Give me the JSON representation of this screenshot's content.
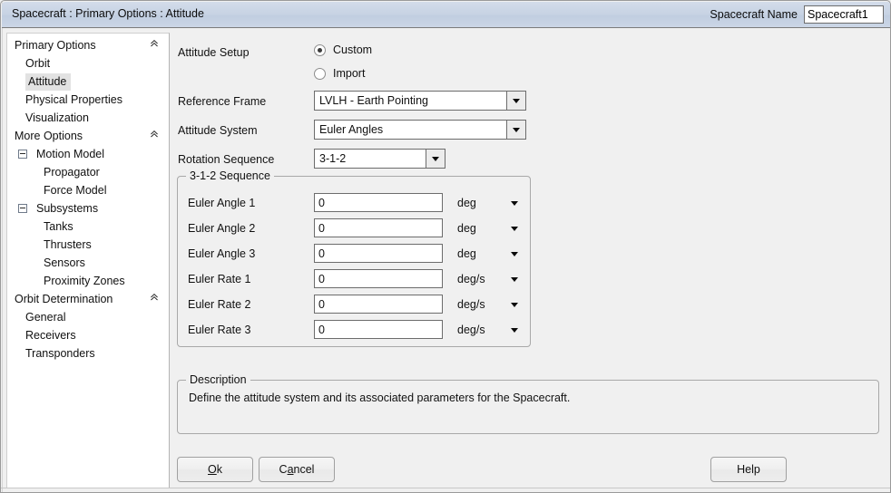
{
  "window": {
    "title": "Spacecraft : Primary Options : Attitude",
    "spacecraft_name_label": "Spacecraft Name",
    "spacecraft_name_value": "Spacecraft1"
  },
  "sidebar": {
    "items": [
      {
        "label": "Primary Options",
        "level": "group",
        "chevron": "chevron-double-up-icon",
        "selected": false
      },
      {
        "label": "Orbit",
        "level": "lvl1",
        "selected": false
      },
      {
        "label": "Attitude",
        "level": "lvl1",
        "selected": true
      },
      {
        "label": "Physical Properties",
        "level": "lvl1",
        "selected": false
      },
      {
        "label": "Visualization",
        "level": "lvl1",
        "selected": false
      },
      {
        "label": "More Options",
        "level": "group",
        "chevron": "chevron-double-up-icon",
        "selected": false
      },
      {
        "label": "Motion Model",
        "level": "lvl1b",
        "expander": "minus-box-icon",
        "selected": false
      },
      {
        "label": "Propagator",
        "level": "lvl2",
        "selected": false
      },
      {
        "label": "Force Model",
        "level": "lvl2",
        "selected": false
      },
      {
        "label": "Subsystems",
        "level": "lvl1b",
        "expander": "minus-box-icon",
        "selected": false
      },
      {
        "label": "Tanks",
        "level": "lvl2",
        "selected": false
      },
      {
        "label": "Thrusters",
        "level": "lvl2",
        "selected": false
      },
      {
        "label": "Sensors",
        "level": "lvl2",
        "selected": false
      },
      {
        "label": "Proximity Zones",
        "level": "lvl2",
        "selected": false
      },
      {
        "label": "Orbit Determination",
        "level": "group",
        "chevron": "chevron-double-up-icon",
        "selected": false
      },
      {
        "label": "General",
        "level": "lvl1",
        "selected": false
      },
      {
        "label": "Receivers",
        "level": "lvl1",
        "selected": false
      },
      {
        "label": "Transponders",
        "level": "lvl1",
        "selected": false
      }
    ]
  },
  "form": {
    "attitude_setup_label": "Attitude Setup",
    "radio_custom_label": "Custom",
    "radio_import_label": "Import",
    "radio_selected": "Custom",
    "reference_frame_label": "Reference Frame",
    "reference_frame_value": "LVLH - Earth Pointing",
    "attitude_system_label": "Attitude System",
    "attitude_system_value": "Euler Angles",
    "rotation_sequence_label": "Rotation Sequence",
    "rotation_sequence_value": "3-1-2"
  },
  "sequence_group": {
    "title": "3-1-2 Sequence",
    "rows": [
      {
        "label": "Euler Angle 1",
        "value": "0",
        "unit": "deg"
      },
      {
        "label": "Euler Angle 2",
        "value": "0",
        "unit": "deg"
      },
      {
        "label": "Euler Angle 3",
        "value": "0",
        "unit": "deg"
      },
      {
        "label": "Euler Rate 1",
        "value": "0",
        "unit": "deg/s"
      },
      {
        "label": "Euler Rate 2",
        "value": "0",
        "unit": "deg/s"
      },
      {
        "label": "Euler Rate 3",
        "value": "0",
        "unit": "deg/s"
      }
    ]
  },
  "description": {
    "title": "Description",
    "text": "Define the attitude system and its associated parameters for the Spacecraft."
  },
  "buttons": {
    "ok": "Ok",
    "ok_mnemonic": "O",
    "cancel": "Cancel",
    "cancel_mnemonic": "a",
    "help": "Help"
  },
  "colors": {
    "titlebar": "#c6d2e3",
    "panel_bg": "#f0f0f0",
    "sidebar_bg": "#ffffff",
    "selection": "#e2e2e2",
    "border": "#6c6c6c"
  }
}
